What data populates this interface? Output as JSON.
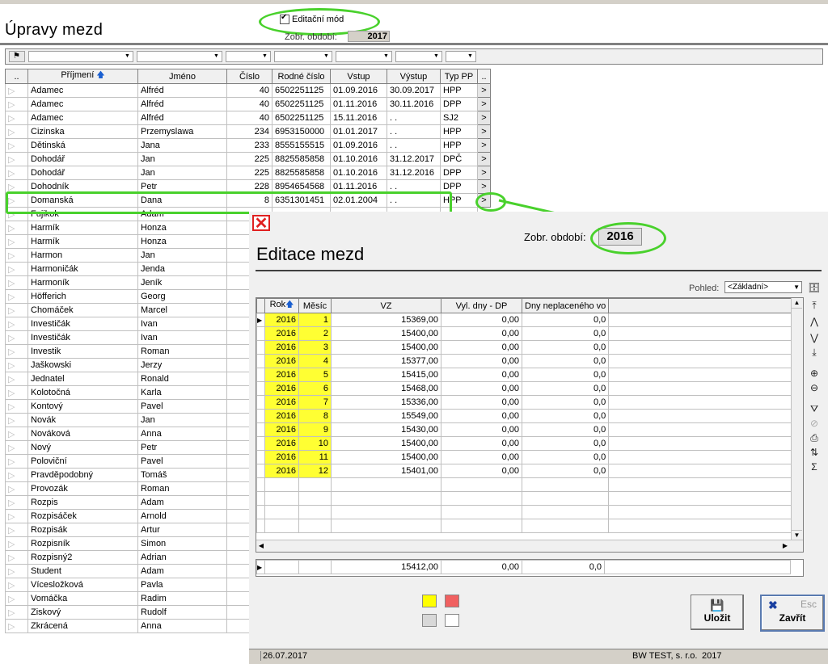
{
  "page": {
    "title": "Úpravy mezd",
    "edit_mode_label": "Editační mód",
    "period_label": "Zobr. období:",
    "period_value": "2017"
  },
  "main_grid": {
    "columns": [
      "..",
      "Příjmení",
      "Jméno",
      "Číslo",
      "Rodné číslo",
      "Vstup",
      "Výstup",
      "Typ PP",
      ".."
    ],
    "rows": [
      [
        "Adamec",
        "Alfréd",
        "40",
        "6502251125",
        "01.09.2016",
        "30.09.2017",
        "HPP"
      ],
      [
        "Adamec",
        "Alfréd",
        "40",
        "6502251125",
        "01.11.2016",
        "30.11.2016",
        "DPP"
      ],
      [
        "Adamec",
        "Alfréd",
        "40",
        "6502251125",
        "15.11.2016",
        ". .",
        "SJ2"
      ],
      [
        "Cizinska",
        "Przemyslawa",
        "234",
        "6953150000",
        "01.01.2017",
        ". .",
        "HPP"
      ],
      [
        "Dětinská",
        "Jana",
        "233",
        "8555155515",
        "01.09.2016",
        ". .",
        "HPP"
      ],
      [
        "Dohodář",
        "Jan",
        "225",
        "8825585858",
        "01.10.2016",
        "31.12.2017",
        "DPČ"
      ],
      [
        "Dohodář",
        "Jan",
        "225",
        "8825585858",
        "01.10.2016",
        "31.12.2016",
        "DPP"
      ],
      [
        "Dohodník",
        "Petr",
        "228",
        "8954654568",
        "01.11.2016",
        ". .",
        "DPP"
      ],
      [
        "Domanská",
        "Dana",
        "8",
        "6351301451",
        "02.01.2004",
        ". .",
        "HPP"
      ],
      [
        "Fujikok",
        "Adam",
        "",
        "",
        "",
        "",
        ""
      ],
      [
        "Harmík",
        "Honza",
        "",
        "",
        "",
        "",
        ""
      ],
      [
        "Harmík",
        "Honza",
        "",
        "",
        "",
        "",
        ""
      ],
      [
        "Harmon",
        "Jan",
        "",
        "",
        "",
        "",
        ""
      ],
      [
        "Harmoničák",
        "Jenda",
        "",
        "",
        "",
        "",
        ""
      ],
      [
        "Harmoník",
        "Jeník",
        "",
        "",
        "",
        "",
        ""
      ],
      [
        "Höfferich",
        "Georg",
        "",
        "",
        "",
        "",
        ""
      ],
      [
        "Chomáček",
        "Marcel",
        "",
        "",
        "",
        "",
        ""
      ],
      [
        "Investičák",
        "Ivan",
        "",
        "",
        "",
        "",
        ""
      ],
      [
        "Investičák",
        "Ivan",
        "",
        "",
        "",
        "",
        ""
      ],
      [
        "Investik",
        "Roman",
        "",
        "",
        "",
        "",
        ""
      ],
      [
        "Jaškowski",
        "Jerzy",
        "",
        "",
        "",
        "",
        ""
      ],
      [
        "Jednatel",
        "Ronald",
        "",
        "",
        "",
        "",
        ""
      ],
      [
        "Kolotočná",
        "Karla",
        "",
        "",
        "",
        "",
        ""
      ],
      [
        "Kontový",
        "Pavel",
        "",
        "",
        "",
        "",
        ""
      ],
      [
        "Novák",
        "Jan",
        "",
        "",
        "",
        "",
        ""
      ],
      [
        "Nováková",
        "Anna",
        "",
        "",
        "",
        "",
        ""
      ],
      [
        "Nový",
        "Petr",
        "",
        "",
        "",
        "",
        ""
      ],
      [
        "Poloviční",
        "Pavel",
        "",
        "",
        "",
        "",
        ""
      ],
      [
        "Pravděpodobný",
        "Tomáš",
        "",
        "",
        "",
        "",
        ""
      ],
      [
        "Provozák",
        "Roman",
        "",
        "",
        "",
        "",
        ""
      ],
      [
        "Rozpis",
        "Adam",
        "",
        "",
        "",
        "",
        ""
      ],
      [
        "Rozpisáček",
        "Arnold",
        "",
        "",
        "",
        "",
        ""
      ],
      [
        "Rozpisák",
        "Artur",
        "",
        "",
        "",
        "",
        ""
      ],
      [
        "Rozpisník",
        "Simon",
        "",
        "",
        "",
        "",
        ""
      ],
      [
        "Rozpisný2",
        "Adrian",
        "",
        "",
        "",
        "",
        ""
      ],
      [
        "Student",
        "Adam",
        "",
        "",
        "",
        "",
        ""
      ],
      [
        "Vícesložková",
        "Pavla",
        "",
        "",
        "",
        "",
        ""
      ],
      [
        "Vomáčka",
        "Radim",
        "",
        "",
        "",
        "",
        ""
      ],
      [
        "Ziskový",
        "Rudolf",
        "",
        "",
        "",
        "",
        ""
      ],
      [
        "Zkrácená",
        "Anna",
        "",
        "",
        "",
        "",
        ""
      ]
    ],
    "row_button_label": ">"
  },
  "dialog": {
    "title": "Editace mezd",
    "close_glyph": "✕",
    "period_label": "Zobr. období:",
    "period_value": "2016",
    "view_label": "Pohled:",
    "view_value": "<Základní>",
    "columns": [
      "Rok",
      "Měsíc",
      "VZ",
      "Vyl. dny - DP",
      "Dny neplaceného vo"
    ],
    "rows": [
      [
        "2016",
        "1",
        "15369,00",
        "0,00",
        "0,0"
      ],
      [
        "2016",
        "2",
        "15400,00",
        "0,00",
        "0,0"
      ],
      [
        "2016",
        "3",
        "15400,00",
        "0,00",
        "0,0"
      ],
      [
        "2016",
        "4",
        "15377,00",
        "0,00",
        "0,0"
      ],
      [
        "2016",
        "5",
        "15415,00",
        "0,00",
        "0,0"
      ],
      [
        "2016",
        "6",
        "15468,00",
        "0,00",
        "0,0"
      ],
      [
        "2016",
        "7",
        "15336,00",
        "0,00",
        "0,0"
      ],
      [
        "2016",
        "8",
        "15549,00",
        "0,00",
        "0,0"
      ],
      [
        "2016",
        "9",
        "15430,00",
        "0,00",
        "0,0"
      ],
      [
        "2016",
        "10",
        "15400,00",
        "0,00",
        "0,0"
      ],
      [
        "2016",
        "11",
        "15400,00",
        "0,00",
        "0,0"
      ],
      [
        "2016",
        "12",
        "15401,00",
        "0,00",
        "0,0"
      ]
    ],
    "totals": [
      "15412,00",
      "0,00",
      "0,0"
    ],
    "save_label": "Uložit",
    "close_label": "Zavřít",
    "esc_label": "Esc",
    "status_date": "26.07.2017",
    "status_company": "BW TEST, s. r.o.",
    "status_year": "2017",
    "swatch_colors": [
      "#ffff00",
      "#f06060",
      "#d8d8d8",
      "#ffffff"
    ]
  }
}
